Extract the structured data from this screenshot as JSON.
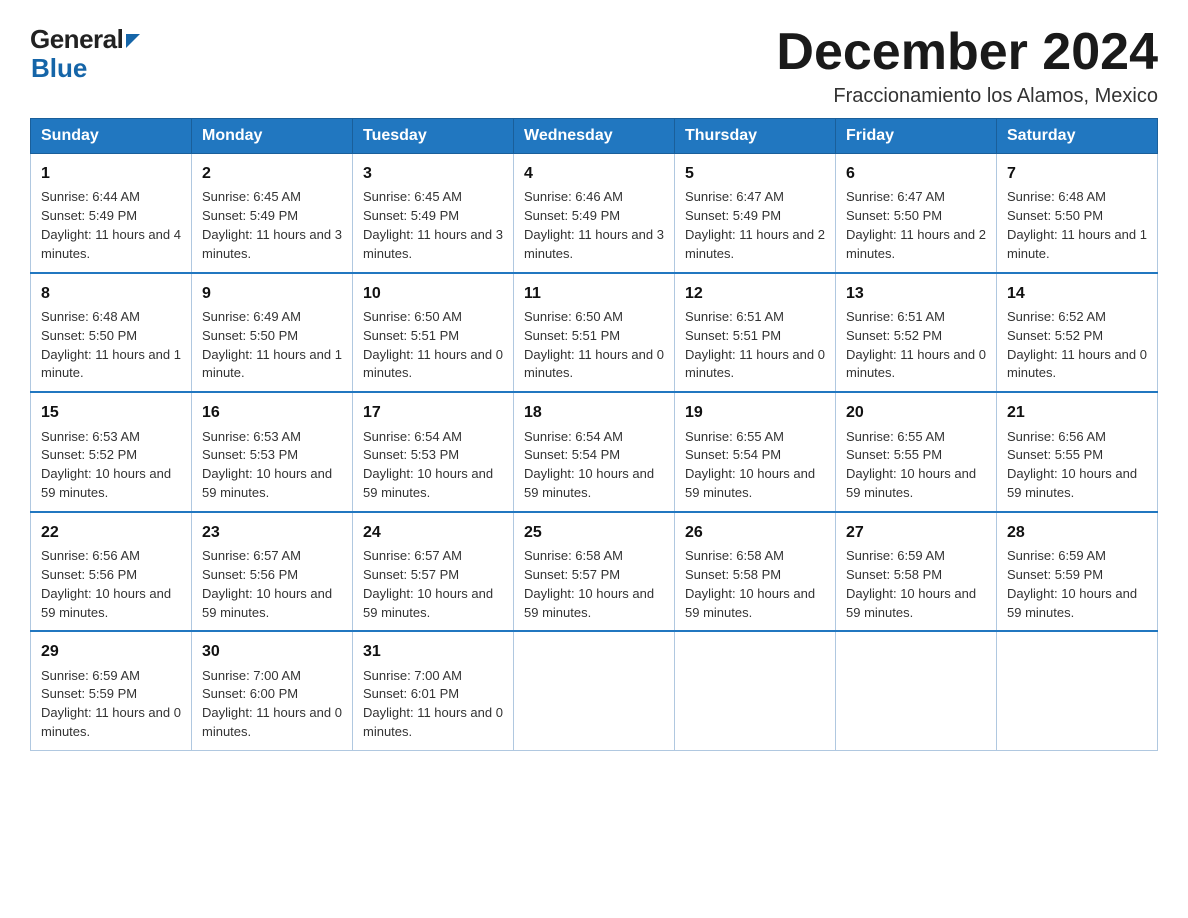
{
  "header": {
    "logo_general": "General",
    "logo_blue": "Blue",
    "month_year": "December 2024",
    "location": "Fraccionamiento los Alamos, Mexico"
  },
  "days_of_week": [
    "Sunday",
    "Monday",
    "Tuesday",
    "Wednesday",
    "Thursday",
    "Friday",
    "Saturday"
  ],
  "weeks": [
    [
      {
        "day": "1",
        "sunrise": "6:44 AM",
        "sunset": "5:49 PM",
        "daylight": "11 hours and 4 minutes."
      },
      {
        "day": "2",
        "sunrise": "6:45 AM",
        "sunset": "5:49 PM",
        "daylight": "11 hours and 3 minutes."
      },
      {
        "day": "3",
        "sunrise": "6:45 AM",
        "sunset": "5:49 PM",
        "daylight": "11 hours and 3 minutes."
      },
      {
        "day": "4",
        "sunrise": "6:46 AM",
        "sunset": "5:49 PM",
        "daylight": "11 hours and 3 minutes."
      },
      {
        "day": "5",
        "sunrise": "6:47 AM",
        "sunset": "5:49 PM",
        "daylight": "11 hours and 2 minutes."
      },
      {
        "day": "6",
        "sunrise": "6:47 AM",
        "sunset": "5:50 PM",
        "daylight": "11 hours and 2 minutes."
      },
      {
        "day": "7",
        "sunrise": "6:48 AM",
        "sunset": "5:50 PM",
        "daylight": "11 hours and 1 minute."
      }
    ],
    [
      {
        "day": "8",
        "sunrise": "6:48 AM",
        "sunset": "5:50 PM",
        "daylight": "11 hours and 1 minute."
      },
      {
        "day": "9",
        "sunrise": "6:49 AM",
        "sunset": "5:50 PM",
        "daylight": "11 hours and 1 minute."
      },
      {
        "day": "10",
        "sunrise": "6:50 AM",
        "sunset": "5:51 PM",
        "daylight": "11 hours and 0 minutes."
      },
      {
        "day": "11",
        "sunrise": "6:50 AM",
        "sunset": "5:51 PM",
        "daylight": "11 hours and 0 minutes."
      },
      {
        "day": "12",
        "sunrise": "6:51 AM",
        "sunset": "5:51 PM",
        "daylight": "11 hours and 0 minutes."
      },
      {
        "day": "13",
        "sunrise": "6:51 AM",
        "sunset": "5:52 PM",
        "daylight": "11 hours and 0 minutes."
      },
      {
        "day": "14",
        "sunrise": "6:52 AM",
        "sunset": "5:52 PM",
        "daylight": "11 hours and 0 minutes."
      }
    ],
    [
      {
        "day": "15",
        "sunrise": "6:53 AM",
        "sunset": "5:52 PM",
        "daylight": "10 hours and 59 minutes."
      },
      {
        "day": "16",
        "sunrise": "6:53 AM",
        "sunset": "5:53 PM",
        "daylight": "10 hours and 59 minutes."
      },
      {
        "day": "17",
        "sunrise": "6:54 AM",
        "sunset": "5:53 PM",
        "daylight": "10 hours and 59 minutes."
      },
      {
        "day": "18",
        "sunrise": "6:54 AM",
        "sunset": "5:54 PM",
        "daylight": "10 hours and 59 minutes."
      },
      {
        "day": "19",
        "sunrise": "6:55 AM",
        "sunset": "5:54 PM",
        "daylight": "10 hours and 59 minutes."
      },
      {
        "day": "20",
        "sunrise": "6:55 AM",
        "sunset": "5:55 PM",
        "daylight": "10 hours and 59 minutes."
      },
      {
        "day": "21",
        "sunrise": "6:56 AM",
        "sunset": "5:55 PM",
        "daylight": "10 hours and 59 minutes."
      }
    ],
    [
      {
        "day": "22",
        "sunrise": "6:56 AM",
        "sunset": "5:56 PM",
        "daylight": "10 hours and 59 minutes."
      },
      {
        "day": "23",
        "sunrise": "6:57 AM",
        "sunset": "5:56 PM",
        "daylight": "10 hours and 59 minutes."
      },
      {
        "day": "24",
        "sunrise": "6:57 AM",
        "sunset": "5:57 PM",
        "daylight": "10 hours and 59 minutes."
      },
      {
        "day": "25",
        "sunrise": "6:58 AM",
        "sunset": "5:57 PM",
        "daylight": "10 hours and 59 minutes."
      },
      {
        "day": "26",
        "sunrise": "6:58 AM",
        "sunset": "5:58 PM",
        "daylight": "10 hours and 59 minutes."
      },
      {
        "day": "27",
        "sunrise": "6:59 AM",
        "sunset": "5:58 PM",
        "daylight": "10 hours and 59 minutes."
      },
      {
        "day": "28",
        "sunrise": "6:59 AM",
        "sunset": "5:59 PM",
        "daylight": "10 hours and 59 minutes."
      }
    ],
    [
      {
        "day": "29",
        "sunrise": "6:59 AM",
        "sunset": "5:59 PM",
        "daylight": "11 hours and 0 minutes."
      },
      {
        "day": "30",
        "sunrise": "7:00 AM",
        "sunset": "6:00 PM",
        "daylight": "11 hours and 0 minutes."
      },
      {
        "day": "31",
        "sunrise": "7:00 AM",
        "sunset": "6:01 PM",
        "daylight": "11 hours and 0 minutes."
      },
      null,
      null,
      null,
      null
    ]
  ],
  "labels": {
    "sunrise_prefix": "Sunrise: ",
    "sunset_prefix": "Sunset: ",
    "daylight_prefix": "Daylight: "
  }
}
